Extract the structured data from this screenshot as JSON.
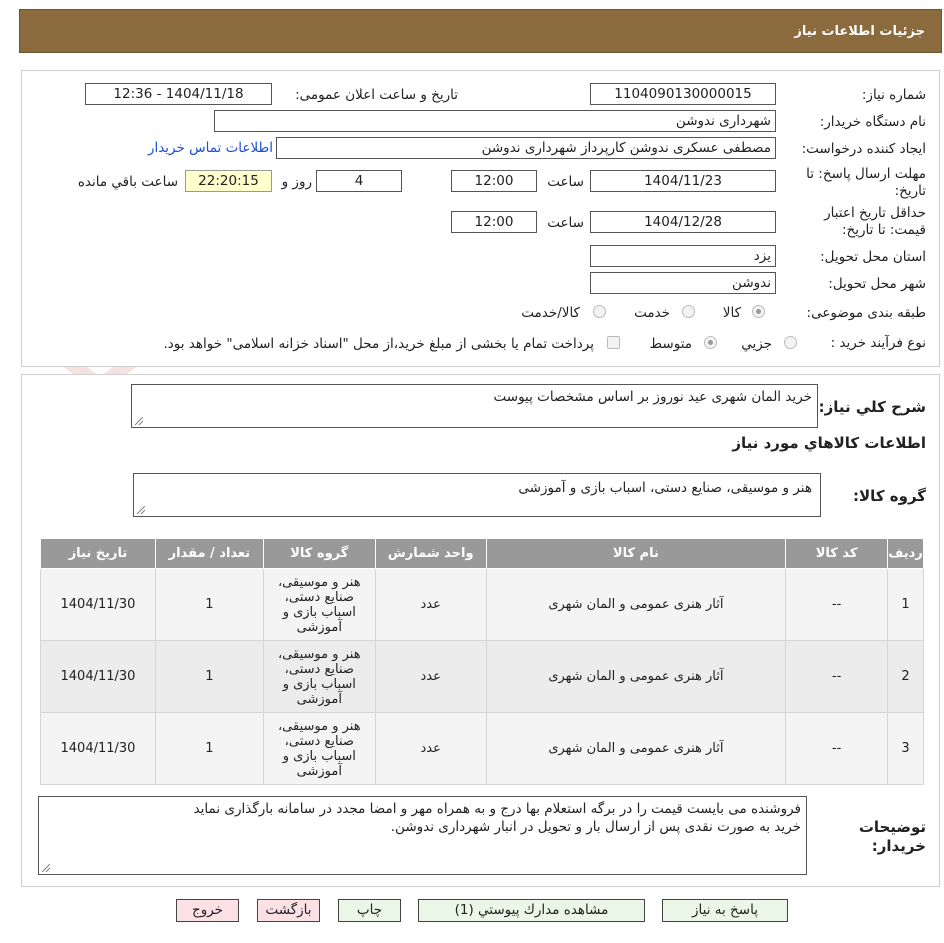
{
  "header": {
    "title": "جزئیات اطلاعات نیاز"
  },
  "form": {
    "need_number_label": "شماره نیاز:",
    "need_number": "1104090130000015",
    "announce_label": "تاریخ و ساعت اعلان عمومی:",
    "announce_value": "1404/11/18 - 12:36",
    "buyer_org_label": "نام دستگاه خریدار:",
    "buyer_org": "شهرداری ندوشن",
    "creator_label": "ایجاد کننده درخواست:",
    "creator": "مصطفی عسکری ندوشن کارپرداز شهرداری ندوشن",
    "contact_link": "اطلاعات تماس خریدار",
    "deadline_label_1": "مهلت ارسال پاسخ: تا",
    "deadline_label_2": "تاریخ:",
    "deadline_date": "1404/11/23",
    "time_label": "ساعت",
    "deadline_time": "12:00",
    "days_value": "4",
    "days_label": "روز و",
    "remaining_time": "22:20:15",
    "remaining_label": "ساعت باقي مانده",
    "validity_label_1": "حداقل تاریخ اعتبار",
    "validity_label_2": "قیمت: تا تاریخ:",
    "validity_date": "1404/12/28",
    "validity_time": "12:00",
    "province_label": "استان محل تحویل:",
    "province": "یزد",
    "city_label": "شهر محل تحویل:",
    "city": "ندوشن",
    "category_label": "طبقه بندی موضوعی:",
    "category_options": [
      "کالا",
      "خدمت",
      "کالا/خدمت"
    ],
    "category_selected": "کالا",
    "process_label": "نوع فرآیند خرید :",
    "process_options": [
      "جزیي",
      "متوسط"
    ],
    "process_selected": "متوسط",
    "payment_note": "پرداخت تمام یا بخشی از مبلغ خرید،از محل \"اسناد خزانه اسلامی\" خواهد بود."
  },
  "summary": {
    "label": "شرح کلي نیاز:",
    "value": "خرید المان شهری عید نوروز بر اساس مشخصات پیوست",
    "items_heading": "اطلاعات کالاهاي مورد نیاز",
    "group_label": "گروه کالا:",
    "group_value": "هنر و موسیقی، صنایع دستی، اسباب بازی و آموزشی"
  },
  "table": {
    "headers": [
      "ردیف",
      "کد کالا",
      "نام کالا",
      "واحد شمارش",
      "گروه کالا",
      "تعداد / مقدار",
      "تاریخ نیاز"
    ],
    "rows": [
      {
        "row": "1",
        "code": "--",
        "name": "آثار هنری عمومی و المان شهری",
        "unit": "عدد",
        "group_lines": [
          "هنر و موسیقی،",
          "صنایع دستی،",
          "اسباب بازی و",
          "آموزشی"
        ],
        "qty": "1",
        "date": "1404/11/30"
      },
      {
        "row": "2",
        "code": "--",
        "name": "آثار هنری عمومی و المان شهری",
        "unit": "عدد",
        "group_lines": [
          "هنر و موسیقی،",
          "صنایع دستی،",
          "اسباب بازی و",
          "آموزشی"
        ],
        "qty": "1",
        "date": "1404/11/30"
      },
      {
        "row": "3",
        "code": "--",
        "name": "آثار هنری عمومی و المان شهری",
        "unit": "عدد",
        "group_lines": [
          "هنر و موسیقی،",
          "صنایع دستی،",
          "اسباب بازی و",
          "آموزشی"
        ],
        "qty": "1",
        "date": "1404/11/30"
      }
    ]
  },
  "buyer_notes": {
    "label_1": "توضیحات",
    "label_2": "خریدار:",
    "line_1": "فروشنده می بایست قیمت را در برگه استعلام بها درج و به همراه مهر و امضا مجدد در سامانه بارگذاری نماید",
    "line_2": "خرید به صورت نقدی پس از ارسال بار و تحویل در انبار شهرداری ندوشن."
  },
  "buttons": {
    "reply": "پاسخ به نیاز",
    "attachments": "مشاهده مدارك پیوستي (1)",
    "print": "چاپ",
    "back": "بازگشت",
    "exit": "خروج"
  },
  "watermark": {
    "text": "AriaTender.neT"
  },
  "colors": {
    "header": "#8b6a3e",
    "table_header": "#999999",
    "link": "#1a4fd6",
    "green_button": "#eaf7e6",
    "red_button": "#fbe0e4"
  }
}
